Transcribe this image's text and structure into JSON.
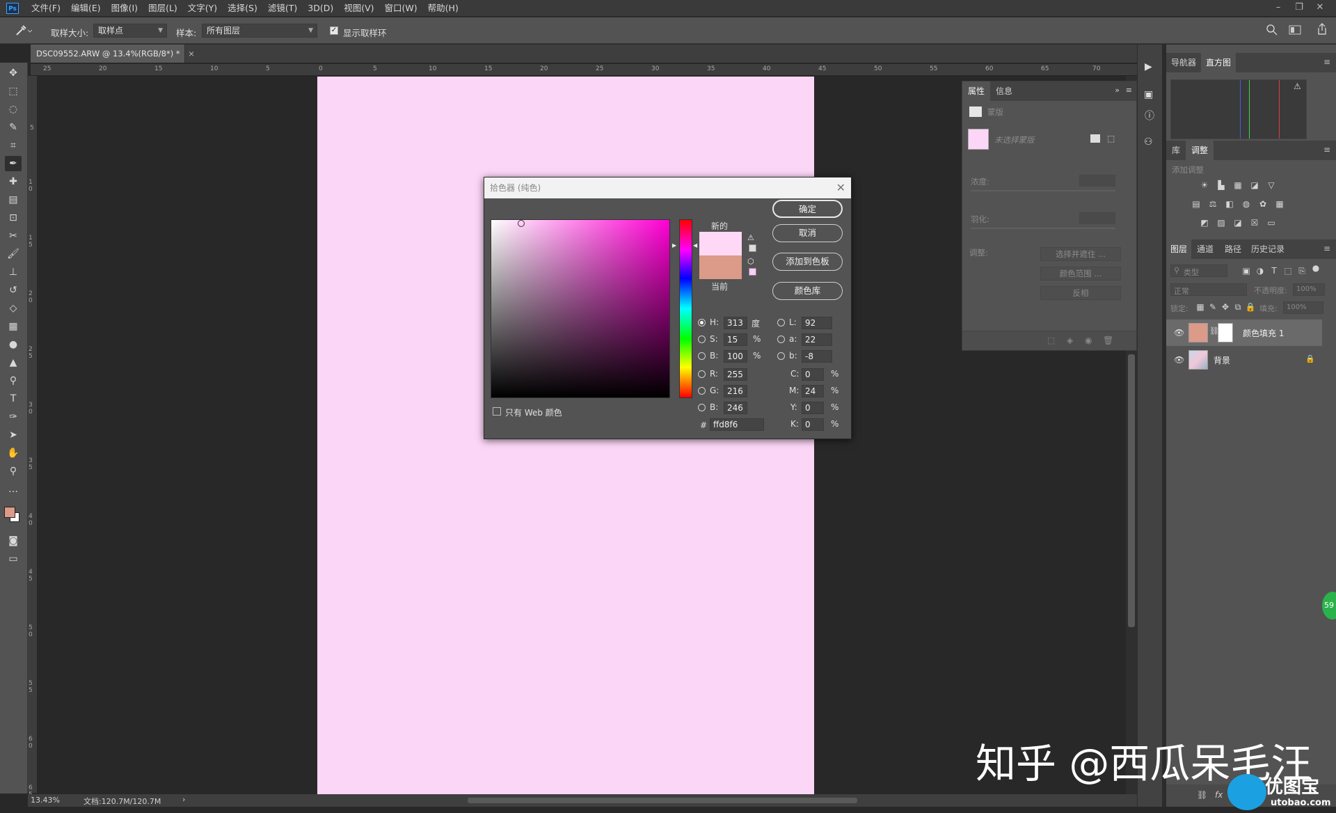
{
  "app": {
    "logo": "Ps",
    "menu": [
      "文件(F)",
      "编辑(E)",
      "图像(I)",
      "图层(L)",
      "文字(Y)",
      "选择(S)",
      "滤镜(T)",
      "3D(D)",
      "视图(V)",
      "窗口(W)",
      "帮助(H)"
    ],
    "window_controls": [
      "–",
      "❐",
      "✕"
    ]
  },
  "options": {
    "sample_size_label": "取样大小:",
    "sample_size_value": "取样点",
    "sample_label": "样本:",
    "sample_value": "所有图层",
    "show_ring_label": "显示取样环",
    "show_ring_checked": true
  },
  "document": {
    "tab_title": "DSC09552.ARW @ 13.4%(RGB/8*) *",
    "tab_close": "×",
    "canvas_color": "#fbd6f6",
    "ruler_top_labels": [
      "25",
      "20",
      "15",
      "10",
      "5",
      "0",
      "5",
      "10",
      "15",
      "20",
      "25",
      "30",
      "35",
      "40",
      "45",
      "50",
      "55",
      "60",
      "65",
      "70"
    ],
    "ruler_left_labels": [
      "5",
      "1 0",
      "1 5",
      "2 0",
      "2 5",
      "3 0",
      "3 5",
      "4 0",
      "4 5",
      "5 0",
      "5 5",
      "6 0",
      "6 5"
    ]
  },
  "status": {
    "zoom": "13.43%",
    "doc_size": "文档:120.7M/120.7M",
    "arrow": "›"
  },
  "properties_panel": {
    "tabs": [
      "属性",
      "信息"
    ],
    "section_title": "蒙版",
    "mask_label": "未选择蒙版",
    "density_label": "浓度:",
    "feather_label": "羽化:",
    "refine_label": "调整:",
    "buttons": [
      "选择并遮住 ...",
      "颜色范围 ...",
      "反相"
    ]
  },
  "right_panel": {
    "top_tabs": [
      "导航器",
      "直方图"
    ],
    "adj_tabs": [
      "库",
      "调整"
    ],
    "add_adjustment": "添加调整",
    "layer_tabs": [
      "图层",
      "通道",
      "路径",
      "历史记录"
    ],
    "filter_placeholder": "类型",
    "blend_mode": "正常",
    "opacity_label": "不透明度:",
    "opacity_value": "100%",
    "lock_label": "锁定:",
    "fill_label": "填充:",
    "fill_value": "100%",
    "layers": [
      {
        "name": "颜色填充 1",
        "selected": true
      },
      {
        "name": "背景",
        "selected": false
      }
    ]
  },
  "color_picker": {
    "title": "拾色器 (纯色)",
    "new_label": "新的",
    "current_label": "当前",
    "new_color": "#ffd8f6",
    "current_color": "#dc9a89",
    "buttons": [
      "确定",
      "取消",
      "添加到色板",
      "颜色库"
    ],
    "web_only_label": "只有 Web 颜色",
    "fields_left": [
      {
        "key": "H:",
        "value": "313",
        "unit": "度",
        "selected": true
      },
      {
        "key": "S:",
        "value": "15",
        "unit": "%",
        "selected": false
      },
      {
        "key": "B:",
        "value": "100",
        "unit": "%",
        "selected": false
      },
      {
        "key": "R:",
        "value": "255",
        "unit": "",
        "selected": false
      },
      {
        "key": "G:",
        "value": "216",
        "unit": "",
        "selected": false
      },
      {
        "key": "B:",
        "value": "246",
        "unit": "",
        "selected": false
      }
    ],
    "fields_lab": [
      {
        "key": "L:",
        "value": "92"
      },
      {
        "key": "a:",
        "value": "22"
      },
      {
        "key": "b:",
        "value": "-8"
      }
    ],
    "fields_cmyk": [
      {
        "key": "C:",
        "value": "0",
        "unit": "%"
      },
      {
        "key": "M:",
        "value": "24",
        "unit": "%"
      },
      {
        "key": "Y:",
        "value": "0",
        "unit": "%"
      },
      {
        "key": "K:",
        "value": "0",
        "unit": "%"
      }
    ],
    "hex_label": "#",
    "hex_value": "ffd8f6"
  },
  "overlay": {
    "watermark": "知乎 @西瓜呆毛汪",
    "site_name": "优图宝",
    "site_url": "utobao.com",
    "badge": "59"
  }
}
